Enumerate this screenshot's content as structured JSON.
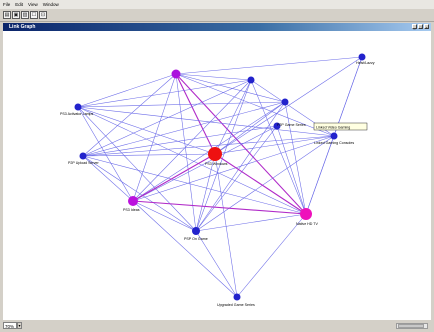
{
  "menu": [
    "File",
    "Edit",
    "View",
    "Window"
  ],
  "toolbar": {
    "buttons": [
      {
        "icon": "open-icon",
        "glyph": "▤"
      },
      {
        "icon": "save-icon",
        "glyph": "▣"
      },
      {
        "icon": "layout-icon",
        "glyph": "▥"
      },
      {
        "icon": "window-icon",
        "glyph": "☐"
      },
      {
        "icon": "export-icon",
        "glyph": "⊡"
      }
    ]
  },
  "window": {
    "title": "Link Graph",
    "controls": [
      "_",
      "□",
      "×"
    ]
  },
  "graph": {
    "nodes": [
      {
        "id": "n1",
        "label": "",
        "color": "#aa11dd"
      },
      {
        "id": "n2",
        "label": "",
        "color": "#2222cc"
      },
      {
        "id": "n3",
        "label": "Heist/Lazzy",
        "color": "#2222cc"
      },
      {
        "id": "n4",
        "label": "PS3 Activator Lamps",
        "color": "#2222cc"
      },
      {
        "id": "n5",
        "label": "",
        "color": "#2222cc"
      },
      {
        "id": "n6",
        "label": "Linked Gaming Consoles",
        "color": "#2222cc"
      },
      {
        "id": "n7",
        "label": "P2P Game Series",
        "color": "#2222cc"
      },
      {
        "id": "n8",
        "label": "P2P Upload Server",
        "color": "#2222cc"
      },
      {
        "id": "n9",
        "label": "PS3 Windows",
        "color": "#ee1111"
      },
      {
        "id": "n10",
        "label": "PS3 Ideas",
        "color": "#bb11dd"
      },
      {
        "id": "n11",
        "label": "Native HD TV",
        "color": "#ee11bb"
      },
      {
        "id": "n12",
        "label": "PSP On Game",
        "color": "#2222cc"
      },
      {
        "id": "n13",
        "label": "Upgraded Game Series",
        "color": "#2222cc"
      }
    ],
    "tooltip": "Linked Video Gaming"
  },
  "status": {
    "zoom": "70%"
  }
}
